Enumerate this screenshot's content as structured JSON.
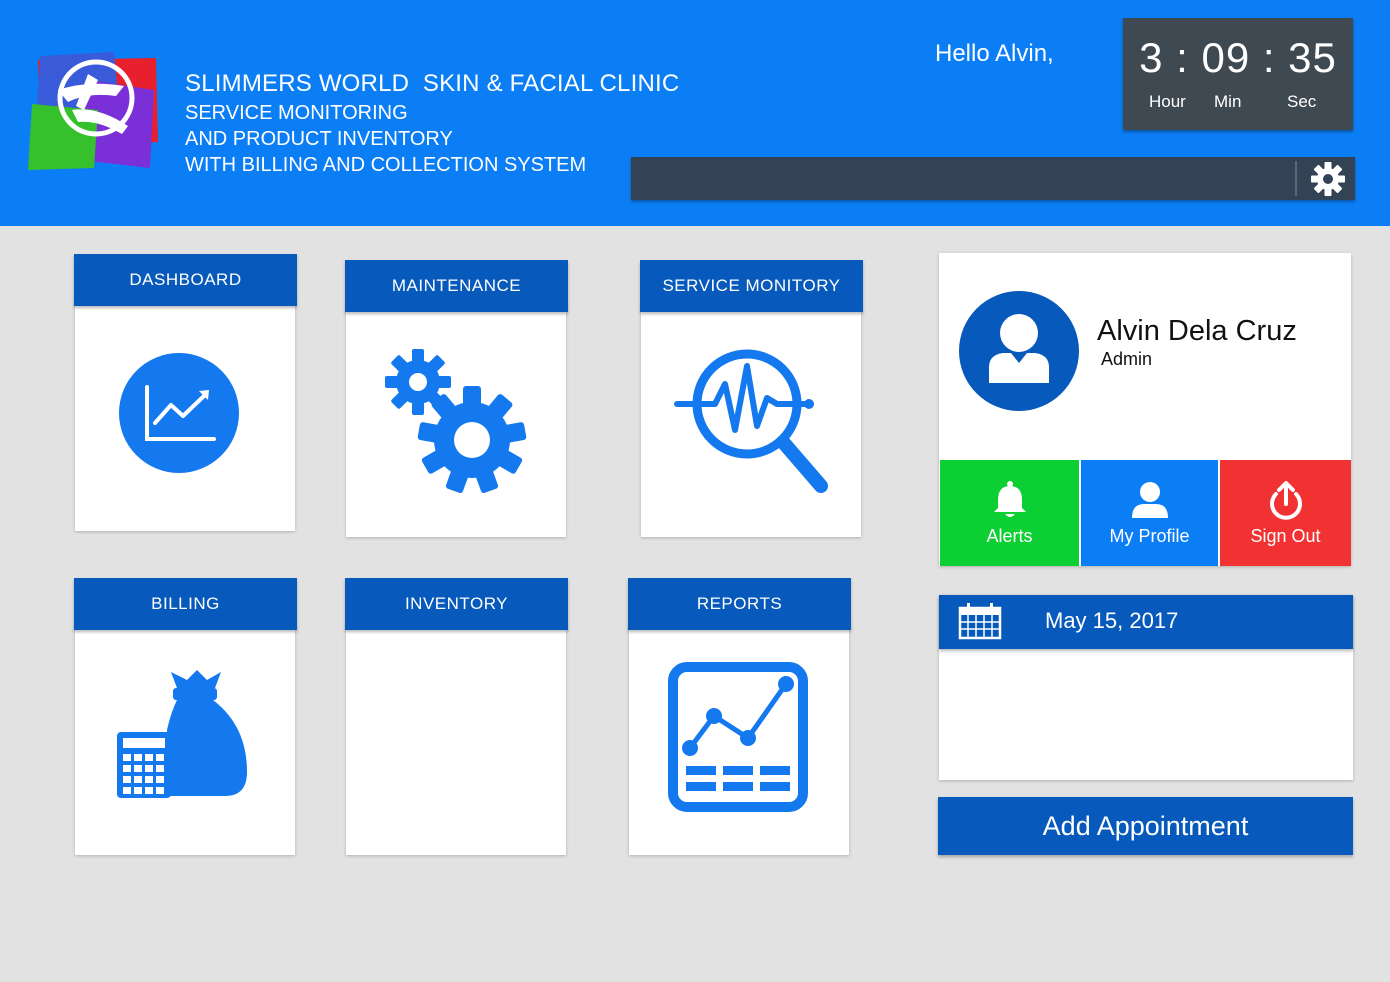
{
  "header": {
    "title_line1": "SLIMMERS WORLD  SKIN & FACIAL CLINIC",
    "title_line2": "SERVICE MONITORING",
    "title_line3": "AND PRODUCT INVENTORY",
    "title_line4": "WITH BILLING AND COLLECTION SYSTEM",
    "greeting": "Hello Alvin,",
    "settings_icon": "gear-icon",
    "logo": "slimmers-world-logo"
  },
  "clock": {
    "display": "3 : 09 : 35",
    "hour_label": "Hour",
    "min_label": "Min",
    "sec_label": "Sec"
  },
  "search": {
    "value": ""
  },
  "modules": {
    "dashboard": {
      "label": "DASHBOARD",
      "icon": "trend-chart-icon"
    },
    "maintenance": {
      "label": "MAINTENANCE",
      "icon": "gears-icon"
    },
    "service_monitory": {
      "label": "SERVICE MONITORY",
      "icon": "pulse-magnifier-icon"
    },
    "billing": {
      "label": "BILLING",
      "icon": "money-bag-calculator-icon"
    },
    "inventory": {
      "label": "INVENTORY",
      "icon": ""
    },
    "reports": {
      "label": "REPORTS",
      "icon": "report-chart-icon"
    }
  },
  "profile": {
    "name": "Alvin Dela Cruz",
    "role": "Admin",
    "actions": {
      "alerts": "Alerts",
      "my_profile": "My Profile",
      "sign_out": "Sign Out"
    }
  },
  "calendar": {
    "date": "May 15, 2017",
    "icon": "calendar-icon"
  },
  "add_appointment": "Add Appointment",
  "colors": {
    "header_blue": "#0b7ef6",
    "dark_blue": "#0759bb",
    "icon_blue": "#1478ef",
    "clock_bg": "#3f4951",
    "search_bg": "#334254",
    "alerts_green": "#0ccf33",
    "profile_blue": "#0b7ef6",
    "signout_red": "#f23132",
    "background": "#e2e2e2"
  }
}
